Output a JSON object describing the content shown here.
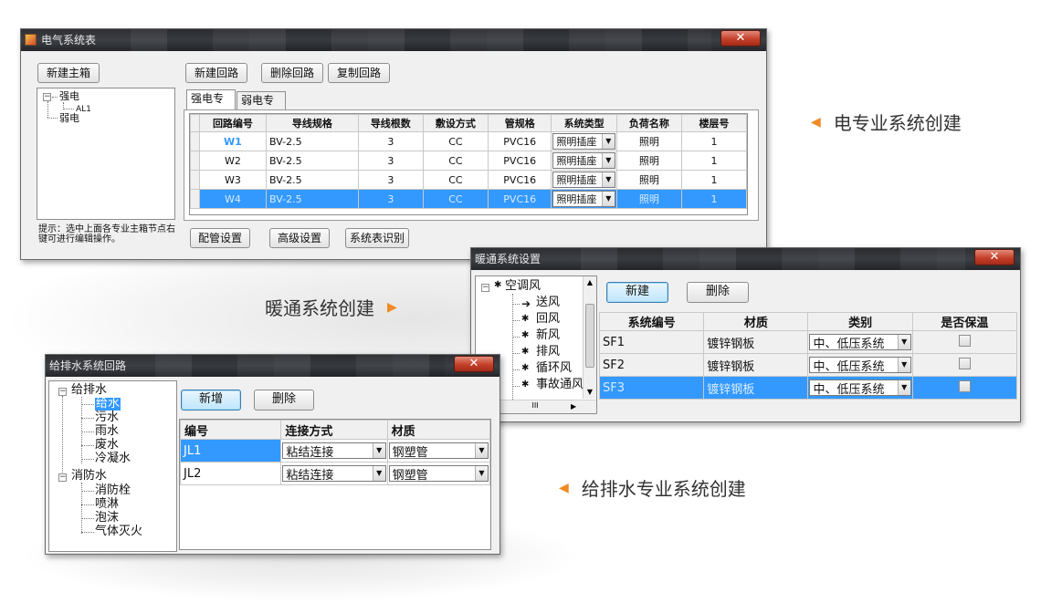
{
  "captions": {
    "elec": "电专业系统创建",
    "hvac": "暖通系统创建",
    "water": "给排水专业系统创建"
  },
  "elec": {
    "title": "电气系统表",
    "close": "✕",
    "new_main_box": "新建主箱",
    "new_loop": "新建回路",
    "delete_loop": "删除回路",
    "copy_loop": "复制回路",
    "tree": {
      "root": "强电",
      "child": "AL1",
      "root2": "弱电",
      "expander": "−"
    },
    "hint": "提示：选中上面各专业主箱节点右键可进行编辑操作。",
    "tabs": [
      "强电专业",
      "弱电专业"
    ],
    "columns": [
      "回路编号",
      "导线规格",
      "导线根数",
      "敷设方式",
      "管规格",
      "系统类型",
      "负荷名称",
      "楼层号"
    ],
    "rows": [
      [
        "W1",
        "BV-2.5",
        "3",
        "CC",
        "PVC16",
        "照明插座",
        "照明",
        "1"
      ],
      [
        "W2",
        "BV-2.5",
        "3",
        "CC",
        "PVC16",
        "照明插座",
        "照明",
        "1"
      ],
      [
        "W3",
        "BV-2.5",
        "3",
        "CC",
        "PVC16",
        "照明插座",
        "照明",
        "1"
      ],
      [
        "W4",
        "BV-2.5",
        "3",
        "CC",
        "PVC16",
        "照明插座",
        "照明",
        "1"
      ]
    ],
    "selected_row": 3,
    "pipe_settings": "配管设置",
    "advanced": "高级设置",
    "recognize": "系统表识别"
  },
  "hvac": {
    "title": "暖通系统设置",
    "close": "✕",
    "tree": {
      "root": "空调风",
      "items": [
        "送风",
        "回风",
        "新风",
        "排风",
        "循环风",
        "事故通风"
      ],
      "expander": "−"
    },
    "new": "新建",
    "delete": "删除",
    "columns": [
      "系统编号",
      "材质",
      "类别",
      "是否保温"
    ],
    "rows": [
      [
        "SF1",
        "镀锌钢板",
        "中、低压系统"
      ],
      [
        "SF2",
        "镀锌钢板",
        "中、低压系统"
      ],
      [
        "SF3",
        "镀锌钢板",
        "中、低压系统"
      ]
    ],
    "selected_row": 2,
    "scroll_label": "III"
  },
  "water": {
    "title": "给排水系统回路",
    "close": "✕",
    "tree": {
      "root1": "给排水",
      "items1": [
        "给水",
        "污水",
        "雨水",
        "废水",
        "冷凝水"
      ],
      "root2": "消防水",
      "items2": [
        "消防栓",
        "喷淋",
        "泡沫",
        "气体灭火"
      ],
      "expander": "−"
    },
    "new": "新增",
    "delete": "删除",
    "columns": [
      "编号",
      "连接方式",
      "材质"
    ],
    "rows": [
      [
        "JL1",
        "粘结连接",
        "钢塑管"
      ],
      [
        "JL2",
        "粘结连接",
        "钢塑管"
      ]
    ],
    "selected_row": 0
  },
  "colors": {
    "selection": "#3399ff",
    "accent_arrow": "#f08a24",
    "close": "#c4402a"
  }
}
